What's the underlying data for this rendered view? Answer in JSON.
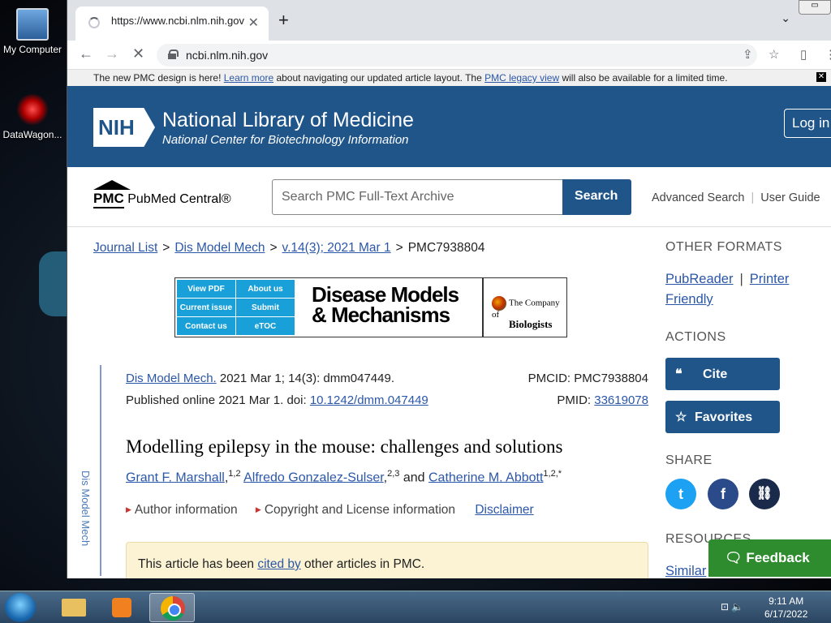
{
  "desktop": {
    "icons": [
      {
        "label": "My Computer",
        "icon": "computer-icon"
      },
      {
        "label": "DataWagon...",
        "icon": "datawagon-icon"
      }
    ]
  },
  "browser": {
    "tab_title": "https://www.ncbi.nlm.nih.gov",
    "url": "ncbi.nlm.nih.gov",
    "new_tab": "+"
  },
  "banner": {
    "text1": "The new PMC design is here! ",
    "link1": "Learn more",
    "text2": " about navigating our updated article layout. The ",
    "link2": "PMC legacy view",
    "text3": " will also be available for a limited time."
  },
  "header": {
    "nih": "NIH",
    "title": "National Library of Medicine",
    "subtitle": "National Center for Biotechnology Information",
    "login": "Log in"
  },
  "search": {
    "logo_pmc": "PMC",
    "logo_text": "PubMed Central®",
    "placeholder": "Search PMC Full-Text Archive",
    "button": "Search",
    "advanced": "Advanced Search",
    "guide": "User Guide"
  },
  "breadcrumb": {
    "items": [
      "Journal List",
      "Dis Model Mech",
      "v.14(3); 2021 Mar 1",
      "PMC7938804"
    ],
    "sep": ">"
  },
  "journal_banner": {
    "links": [
      "View PDF",
      "About us",
      "Current issue",
      "Submit",
      "Contact us",
      "eTOC"
    ],
    "title_line1": "Disease Models",
    "title_line2": "& Mechanisms",
    "publisher_line1": "The Company of",
    "publisher_line2": "Biologists"
  },
  "article": {
    "side_label": "Dis Model Mech",
    "journal_link": "Dis Model Mech.",
    "citation": " 2021 Mar 1; 14(3): dmm047449.",
    "pmcid_label": "PMCID: ",
    "pmcid": "PMC7938804",
    "published": "Published online 2021 Mar 1. doi: ",
    "doi": "10.1242/dmm.047449",
    "pmid_label": "PMID: ",
    "pmid": "33619078",
    "title": "Modelling epilepsy in the mouse: challenges and solutions",
    "authors": [
      {
        "name": "Grant F. Marshall",
        "sup": "1,2"
      },
      {
        "name": "Alfredo Gonzalez-Sulser",
        "sup": "2,3"
      },
      {
        "name": "Catherine M. Abbott",
        "sup": "1,2,*"
      }
    ],
    "and": " and ",
    "author_info": "Author information",
    "copyright": "Copyright and License information",
    "disclaimer": "Disclaimer",
    "cited_text1": "This article has been ",
    "cited_link": "cited by",
    "cited_text2": " other articles in PMC."
  },
  "sidebar": {
    "other_formats": "OTHER FORMATS",
    "pubreader": "PubReader",
    "printer": "Printer",
    "friendly": "Friendly",
    "actions": "ACTIONS",
    "cite": "Cite",
    "favorites": "Favorites",
    "share": "SHARE",
    "resources": "RESOURCES",
    "similar": "Similar",
    "feedback": "Feedback"
  },
  "taskbar": {
    "time": "9:11 AM",
    "date": "6/17/2022"
  },
  "colors": {
    "ncbi_blue": "#20558a",
    "link": "#2b57a8",
    "feedback_green": "#2e8b2e",
    "twitter": "#1da1f2",
    "facebook": "#2a4a8a",
    "link_share": "#1a2a4a"
  }
}
